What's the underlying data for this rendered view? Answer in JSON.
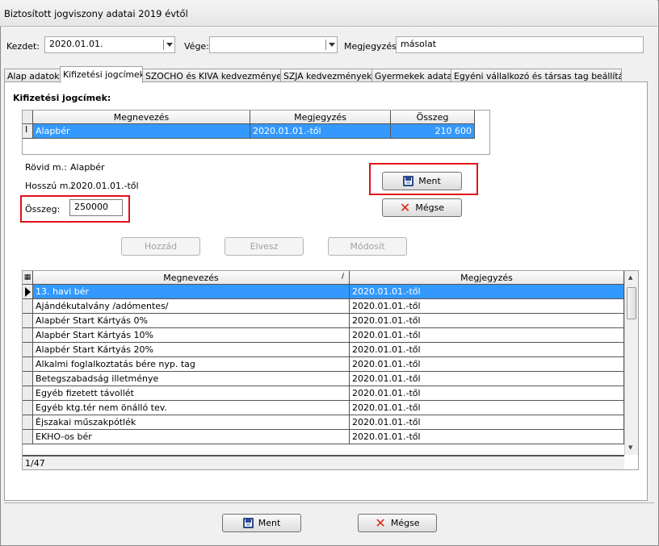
{
  "window": {
    "title": "Biztosított jogviszony adatai 2019 évtől"
  },
  "header": {
    "kezdet_label": "Kezdet:",
    "kezdet_value": "2020.01.01.",
    "vege_label": "Vége:",
    "vege_value": "",
    "megjegyzes_label": "Megjegyzés:",
    "megjegyzes_value": "másolat"
  },
  "tabs": [
    "Alap adatok",
    "Kifizetési jogcímek",
    "SZOCHO és KIVA kedvezmények",
    "SZJA kedvezmények",
    "Gyermekek adatai",
    "Egyéni vállalkozó és társas tag beállítások"
  ],
  "section_title": "Kifizetési jogcímek:",
  "top_grid": {
    "headers": [
      "Megnevezés",
      "Megjegyzés",
      "Összeg"
    ],
    "row": {
      "indicator": "I",
      "name": "Alapbér",
      "note": "2020.01.01.-től",
      "amount": "210 600"
    }
  },
  "detail": {
    "rovid_label": "Rövid m.:",
    "rovid_value": "Alapbér",
    "hosszu_label": "Hosszú m.:",
    "hosszu_value": "2020.01.01.-től",
    "osszeg_label": "Összeg:",
    "osszeg_value": "250000"
  },
  "buttons": {
    "ment": "Ment",
    "megse": "Mégse",
    "hozzad": "Hozzád",
    "elvesz": "Elvesz",
    "modosit": "Módosít"
  },
  "bottom_grid": {
    "headers": [
      "Megnevezés",
      "Megjegyzés"
    ],
    "sort_indicator": "/",
    "counter": "1/47",
    "rows": [
      {
        "name": "13. havi bér",
        "note": "2020.01.01.-től"
      },
      {
        "name": "Ajándékutalvány /adómentes/",
        "note": "2020.01.01.-től"
      },
      {
        "name": "Alapbér Start Kártyás 0%",
        "note": "2020.01.01.-től"
      },
      {
        "name": "Alapbér Start Kártyás 10%",
        "note": "2020.01.01.-től"
      },
      {
        "name": "Alapbér Start Kártyás 20%",
        "note": "2020.01.01.-től"
      },
      {
        "name": "Alkalmi foglalkoztatás bére nyp. tag",
        "note": "2020.01.01.-től"
      },
      {
        "name": "Betegszabadság illetménye",
        "note": "2020.01.01.-től"
      },
      {
        "name": "Egyéb fizetett távollét",
        "note": "2020.01.01.-től"
      },
      {
        "name": "Egyéb ktg.tér nem önálló tev.",
        "note": "2020.01.01.-től"
      },
      {
        "name": "Éjszakai műszakpótlék",
        "note": "2020.01.01.-től"
      },
      {
        "name": "EKHO-os bér",
        "note": "2020.01.01.-től"
      }
    ]
  },
  "footer": {
    "ment": "Ment",
    "megse": "Mégse"
  }
}
